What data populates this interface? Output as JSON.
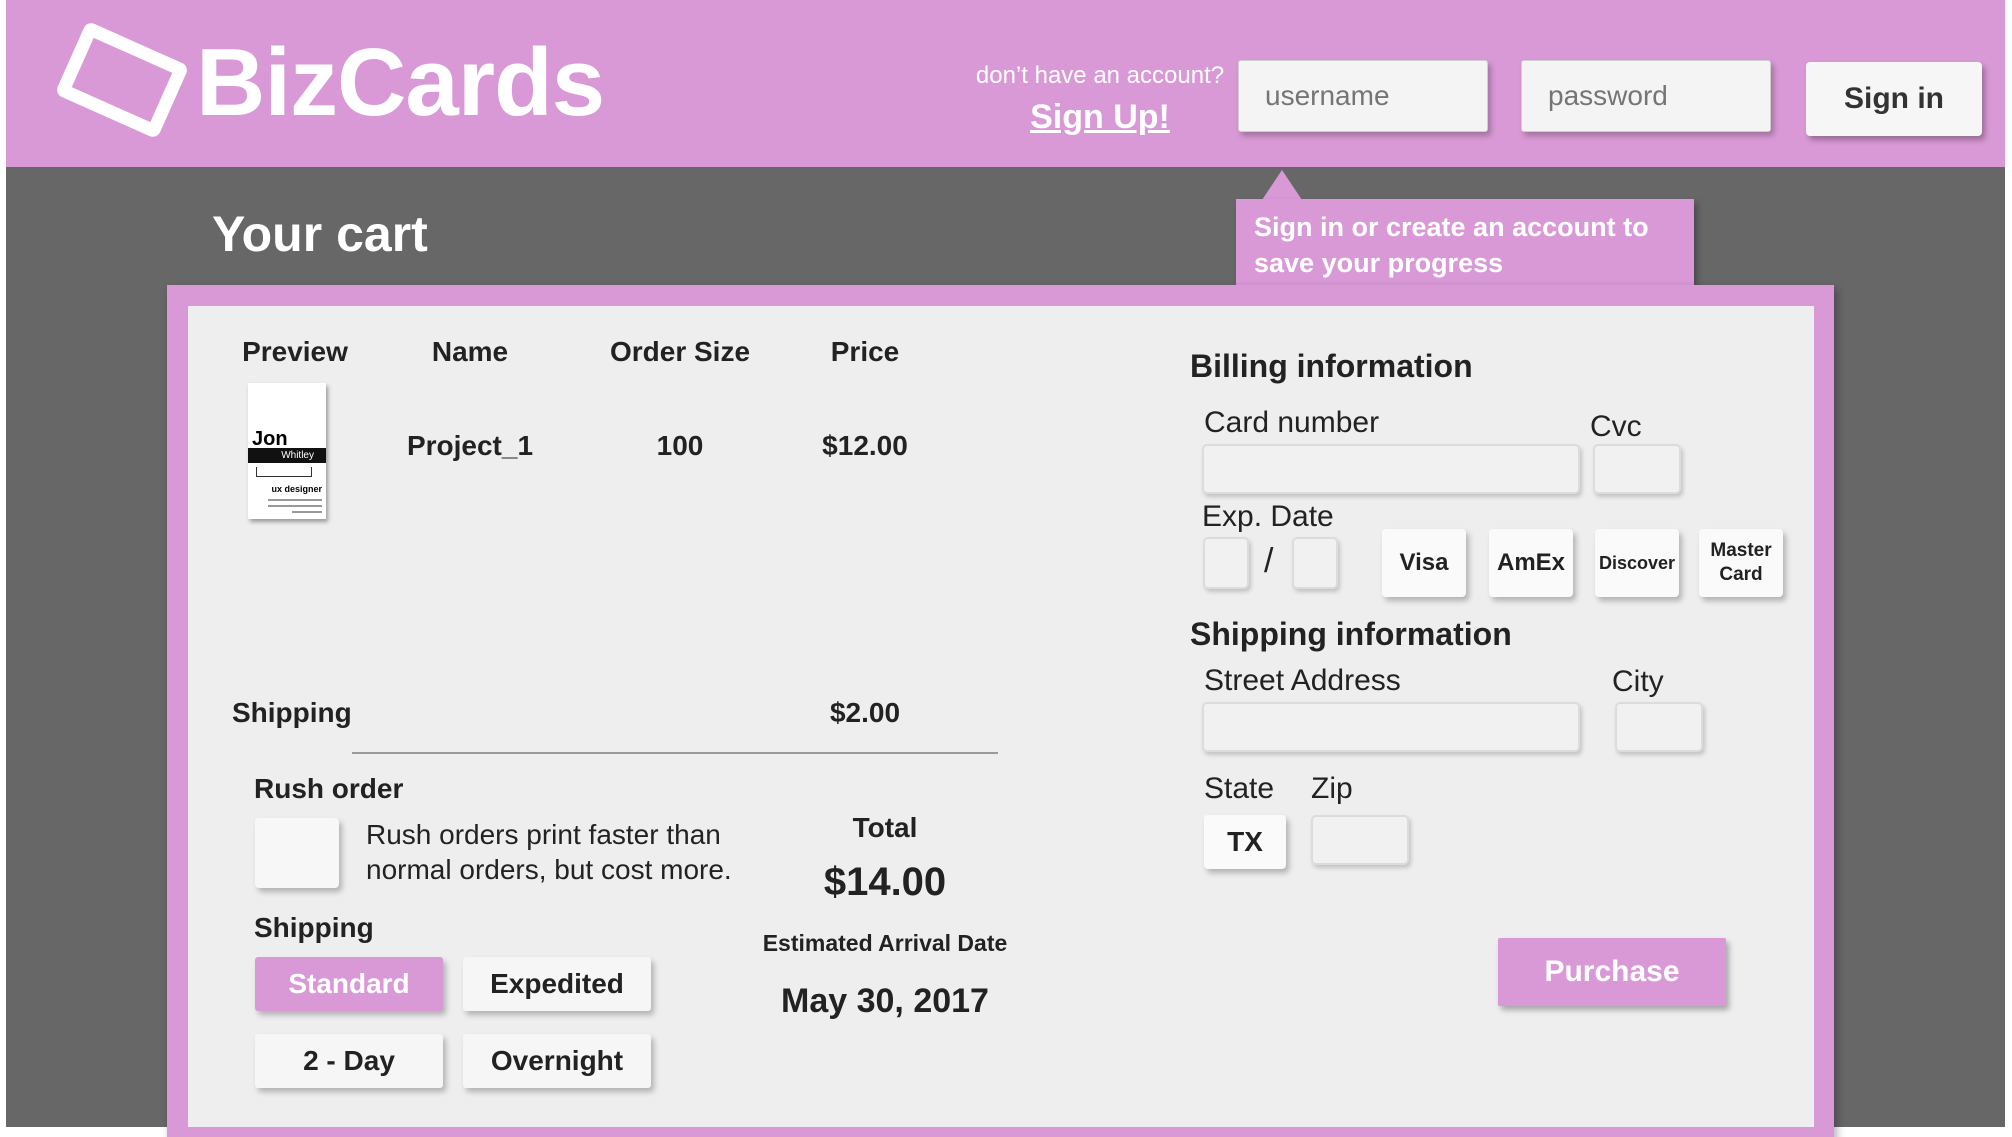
{
  "header": {
    "logo_text": "BizCards",
    "no_account_text": "don’t have an account?",
    "signup_link": "Sign Up!",
    "username_placeholder": "username",
    "password_placeholder": "password",
    "signin_label": "Sign in"
  },
  "tooltip": {
    "text": "Sign in or create an account to save your progress"
  },
  "cart": {
    "title": "Your cart",
    "columns": [
      "Preview",
      "Name",
      "Order Size",
      "Price"
    ],
    "items": [
      {
        "name": "Project_1",
        "order_size": "100",
        "price": "$12.00",
        "preview": {
          "first_name": "Jon",
          "last_name": "Whitley",
          "job_title": "ux designer"
        }
      }
    ],
    "shipping_label": "Shipping",
    "shipping_price": "$2.00",
    "rush": {
      "title": "Rush order",
      "description": "Rush orders print faster than normal orders, but cost more."
    },
    "shipping_method": {
      "title": "Shipping",
      "options": [
        "Standard",
        "Expedited",
        "2 - Day",
        "Overnight"
      ],
      "selected": "Standard"
    },
    "total_label": "Total",
    "total_value": "$14.00",
    "arrival_label": "Estimated Arrival Date",
    "arrival_date": "May 30, 2017"
  },
  "billing": {
    "title": "Billing information",
    "card_number_label": "Card number",
    "cvc_label": "Cvc",
    "exp_label": "Exp. Date",
    "exp_separator": "/",
    "card_types": [
      "Visa",
      "AmEx",
      "Discover",
      "Master Card"
    ]
  },
  "shipping_info": {
    "title": "Shipping information",
    "street_label": "Street Address",
    "city_label": "City",
    "state_label": "State",
    "state_value": "TX",
    "zip_label": "Zip"
  },
  "purchase_label": "Purchase",
  "colors": {
    "accent": "#d999d6",
    "background": "#676767",
    "panel": "#eeeeee"
  }
}
